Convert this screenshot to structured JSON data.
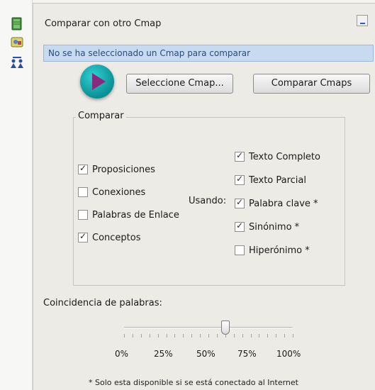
{
  "panel": {
    "title": "Comparar con otro Cmap",
    "status_text": "No se ha seleccionado un Cmap para comparar"
  },
  "buttons": {
    "select_label": "Seleccione Cmap...",
    "compare_label": "Comparar Cmaps"
  },
  "compare_group": {
    "legend": "Comparar",
    "left_options": [
      {
        "label": "Proposiciones",
        "checked": true
      },
      {
        "label": "Conexiones",
        "checked": false
      },
      {
        "label": "Palabras de Enlace",
        "checked": false
      },
      {
        "label": "Conceptos",
        "checked": true
      }
    ],
    "using_label": "Usando:",
    "right_options": [
      {
        "label": "Texto Completo",
        "checked": true
      },
      {
        "label": "Texto Parcial",
        "checked": true
      },
      {
        "label": "Palabra clave *",
        "checked": true
      },
      {
        "label": "Sinónimo *",
        "checked": true
      },
      {
        "label": "Hiperónimo *",
        "checked": false
      }
    ]
  },
  "word_match": {
    "label": "Coincidencia de palabras:",
    "value_percent": 60,
    "scale_labels": [
      "0%",
      "25%",
      "50%",
      "75%",
      "100%"
    ]
  },
  "footnote": "* Solo esta disponible si se está conectado al Internet",
  "icons": {
    "side_icons": [
      "book-icon",
      "map-image-icon",
      "people-compare-icon"
    ],
    "overlay": "play-icon"
  },
  "colors": {
    "status_background": "#c8daf0",
    "play_button": "#0b8f95",
    "play_triangle": "#8a2a7e"
  }
}
